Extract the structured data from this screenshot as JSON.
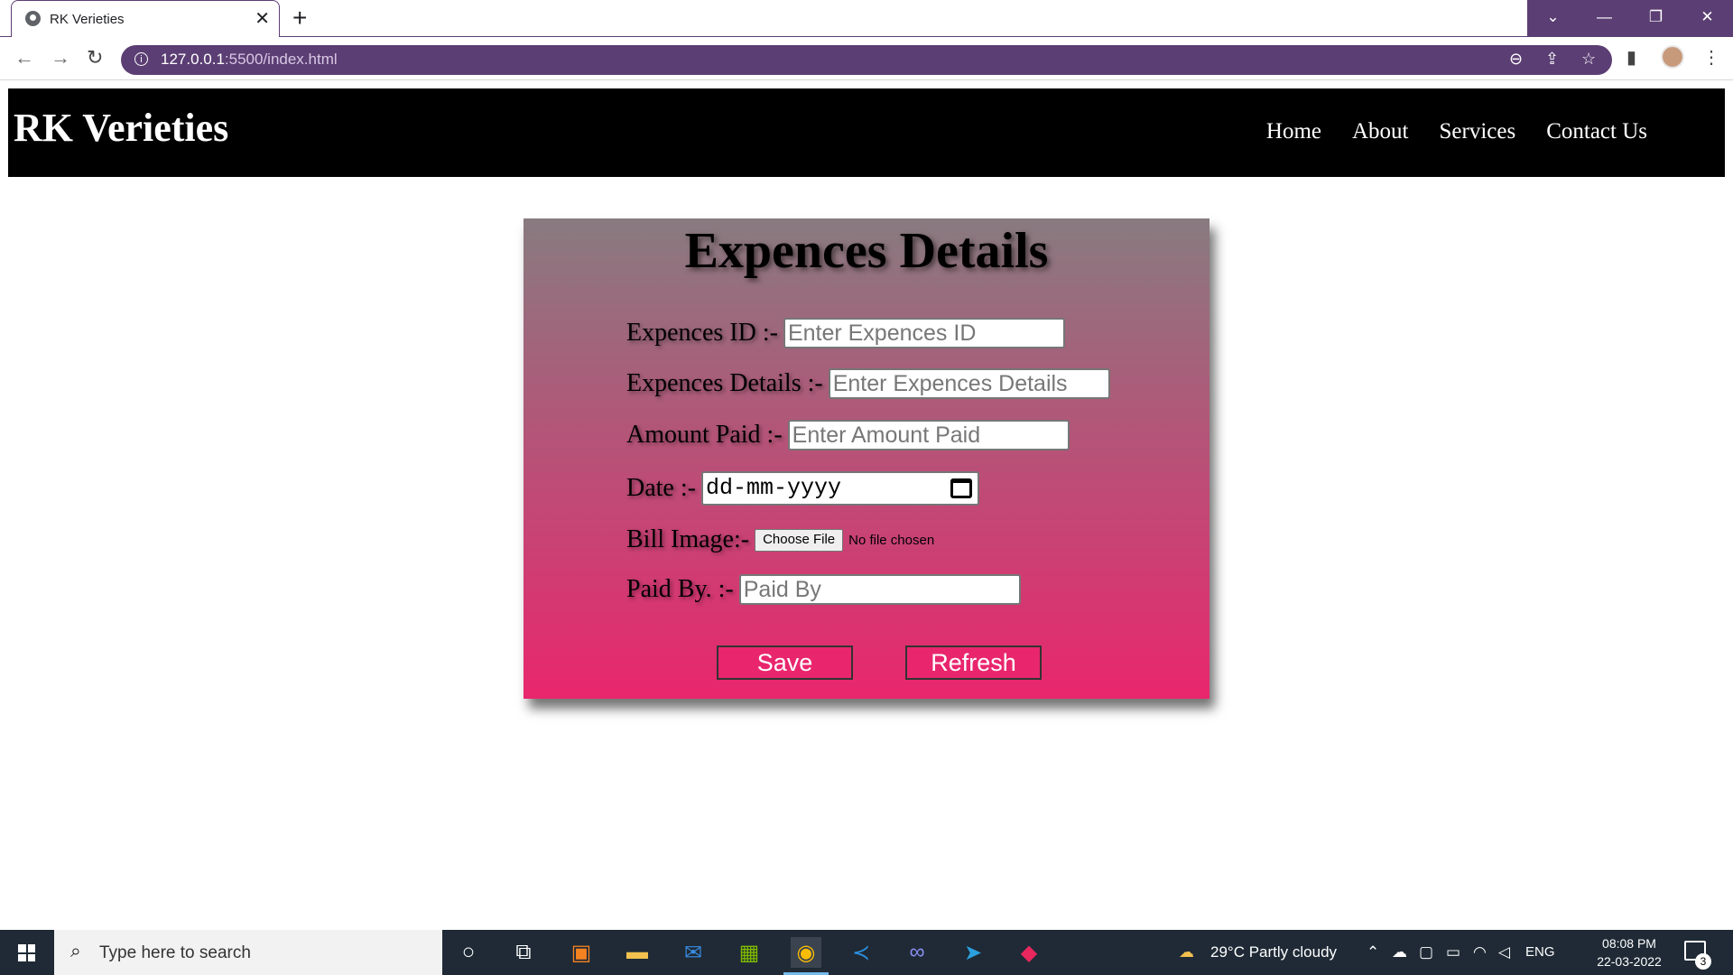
{
  "browser": {
    "tab_title": "RK Verieties",
    "url_host": "127.0.0.1",
    "url_rest": ":5500/index.html",
    "accent_color": "#5b3e73"
  },
  "page": {
    "brand": "RK Verieties",
    "nav": [
      "Home",
      "About",
      "Services",
      "Contact Us"
    ],
    "form": {
      "title": "Expences Details",
      "expences_id": {
        "label": "Expences ID :-",
        "placeholder": "Enter Expences ID"
      },
      "expences_details": {
        "label": "Expences Details :-",
        "placeholder": "Enter Expences Details"
      },
      "amount_paid": {
        "label": "Amount Paid :-",
        "placeholder": "Enter Amount Paid"
      },
      "date": {
        "label": "Date :-",
        "value": "dd-mm-yyyy"
      },
      "bill_image": {
        "label": "Bill Image:-",
        "button": "Choose File",
        "status": "No file chosen"
      },
      "paid_by": {
        "label": "Paid By. :-",
        "placeholder": "Paid By"
      },
      "save": "Save",
      "refresh": "Refresh"
    },
    "colors": {
      "gradient_top": "#887b80",
      "gradient_bottom": "#e9266d",
      "navbar": "#000000"
    }
  },
  "taskbar": {
    "search_placeholder": "Type here to search",
    "weather": "29°C  Partly cloudy",
    "language": "ENG",
    "time": "08:08 PM",
    "date": "22-03-2022",
    "notifications": "3"
  }
}
